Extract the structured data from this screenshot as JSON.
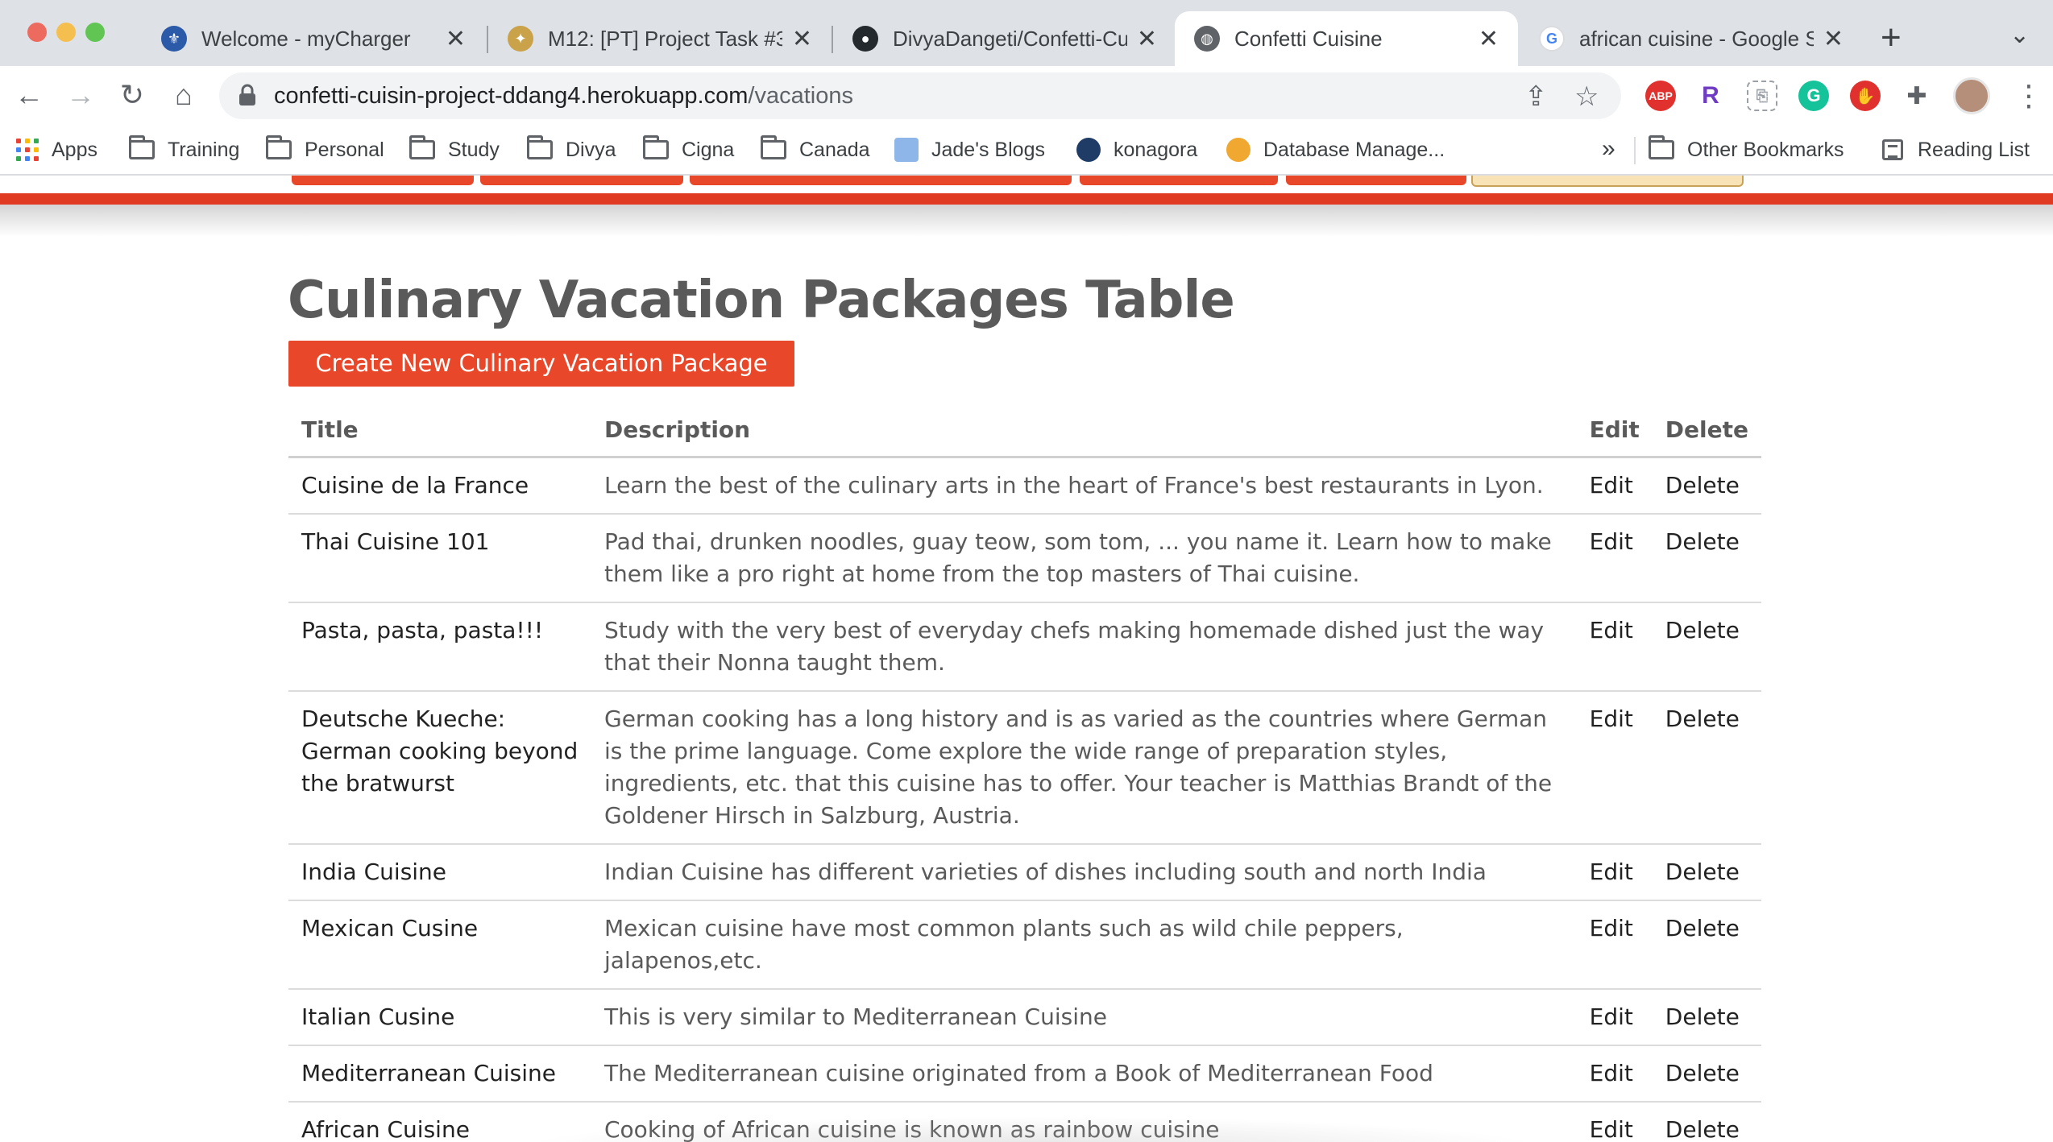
{
  "browser": {
    "tabs": [
      {
        "label": "Welcome - myCharger",
        "icon": "mycharger-icon",
        "active": false
      },
      {
        "label": "M12: [PT] Project Task #3",
        "icon": "course-icon",
        "active": false
      },
      {
        "label": "DivyaDangeti/Confetti-Cui",
        "icon": "github-icon",
        "active": false
      },
      {
        "label": "Confetti Cuisine",
        "icon": "globe-icon",
        "active": true
      },
      {
        "label": "african cuisine - Google S",
        "icon": "google-icon",
        "active": false
      }
    ],
    "url_host": "confetti-cuisin-project-ddang4.herokuapp.com",
    "url_path": "/vacations",
    "bookmarks": [
      {
        "label": "Apps"
      },
      {
        "label": "Training"
      },
      {
        "label": "Personal"
      },
      {
        "label": "Study"
      },
      {
        "label": "Divya"
      },
      {
        "label": "Cigna"
      },
      {
        "label": "Canada"
      },
      {
        "label": "Jade's Blogs"
      },
      {
        "label": "konagora"
      },
      {
        "label": "Database Manage..."
      }
    ],
    "overflow_chevron": "»",
    "other_bookmarks": "Other Bookmarks",
    "reading_list": "Reading List",
    "extensions": {
      "abp": "ABP",
      "r": "R"
    }
  },
  "page": {
    "title": "Culinary Vacation Packages Table",
    "create_button": "Create New Culinary Vacation Package",
    "columns": {
      "title": "Title",
      "description": "Description",
      "edit": "Edit",
      "delete": "Delete"
    },
    "rows": [
      {
        "title": "Cuisine de la France",
        "description": "Learn the best of the culinary arts in the heart of France's best restaurants in Lyon.",
        "edit": "Edit",
        "delete": "Delete"
      },
      {
        "title": "Thai Cuisine 101",
        "description": "Pad thai, drunken noodles, guay teow, som tom, ... you name it. Learn how to make them like a pro right at home from the top masters of Thai cuisine.",
        "edit": "Edit",
        "delete": "Delete"
      },
      {
        "title": "Pasta, pasta, pasta!!!",
        "description": "Study with the very best of everyday chefs making homemade dished just the way that their Nonna taught them.",
        "edit": "Edit",
        "delete": "Delete"
      },
      {
        "title": "Deutsche Kueche: German cooking beyond the bratwurst",
        "description": "German cooking has a long history and is as varied as the countries where German is the prime language. Come explore the wide range of preparation styles, ingredients, etc. that this cuisine has to offer. Your teacher is Matthias Brandt of the Goldener Hirsch in Salzburg, Austria.",
        "edit": "Edit",
        "delete": "Delete"
      },
      {
        "title": "India Cuisine",
        "description": "Indian Cuisine has different varieties of dishes including south and north India",
        "edit": "Edit",
        "delete": "Delete"
      },
      {
        "title": "Mexican Cusine",
        "description": "Mexican cuisine have most common plants such as wild chile peppers, jalapenos,etc.",
        "edit": "Edit",
        "delete": "Delete"
      },
      {
        "title": "Italian Cusine",
        "description": "This is very similar to Mediterranean Cuisine",
        "edit": "Edit",
        "delete": "Delete"
      },
      {
        "title": "Mediterranean Cuisine",
        "description": "The Mediterranean cuisine originated from a Book of Mediterranean Food",
        "edit": "Edit",
        "delete": "Delete"
      },
      {
        "title": "African Cuisine",
        "description": "Cooking of African cuisine is known as rainbow cuisine",
        "edit": "Edit",
        "delete": "Delete"
      }
    ]
  },
  "colors": {
    "accent": "#e8472a",
    "header_bar": "#e03a22",
    "active_nav": "#f7e3b5"
  }
}
